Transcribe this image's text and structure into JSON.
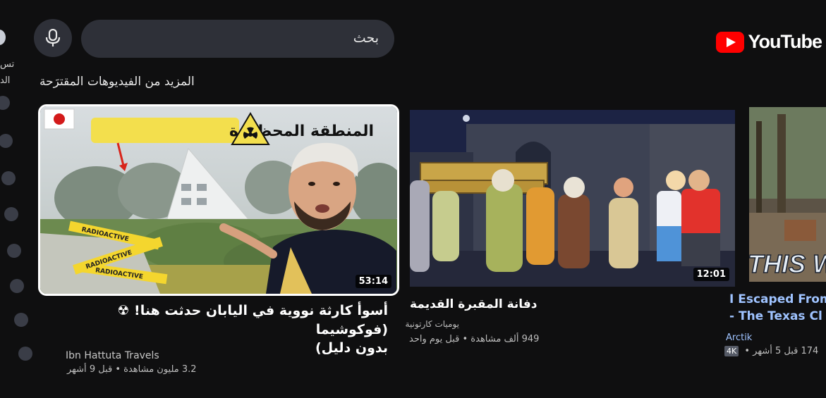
{
  "rail": {
    "text_top": "تس",
    "text_mid": "الد"
  },
  "header": {
    "search_placeholder": "بحث",
    "logo_text": "YouTube"
  },
  "section": {
    "title": "المزيد من الفيديوهات المقترَحة"
  },
  "videos": [
    {
      "thumb_banner": "المنطقة المحظورة",
      "thumb_tape": "RADIOACTIVE",
      "duration": "53:14",
      "title_line1": "أسوأ كارثة نووية في اليابان حدثت هنا! ☢ (فوكوشيما",
      "title_line2": "بدون دليل)",
      "channel": "Ibn Hattuta Travels",
      "stats": "3.2 مليون مشاهدة • قبل 9 أشهر"
    },
    {
      "duration": "12:01",
      "title_line1": "دفانة المقبرة القديمة",
      "channel": "يوميات كارتونية",
      "stats": "949 ألف مشاهدة • قبل يوم واحد"
    },
    {
      "thumb_text": "THIS W",
      "title_line1": "I Escaped From",
      "title_line2": "- The Texas Cl",
      "channel": "Arctik",
      "badge": "4K",
      "stats": "174 قبل 5 أشهر •"
    }
  ],
  "colors": {
    "background": "#0f0f10",
    "brand_red": "#ff0000",
    "selected_border": "#ffffff"
  },
  "icons": [
    "microphone-icon",
    "youtube-logo-icon",
    "japan-flag-icon",
    "radiation-icon"
  ]
}
